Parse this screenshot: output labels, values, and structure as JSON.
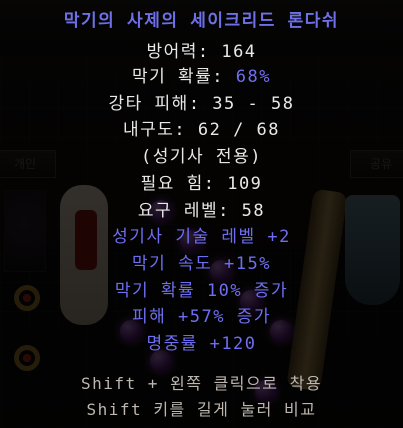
{
  "item": {
    "name": "막기의 사제의 세이크리드 론다쉬",
    "defense_label": "방어력: ",
    "defense_value": "164",
    "block_label": "막기 확률: ",
    "block_value": "68%",
    "smite_label": "강타 피해: ",
    "smite_value": "35 - 58",
    "durability_label": "내구도: ",
    "durability_value": "62 / 68",
    "class_only": "(성기사 전용)",
    "req_str_label": "필요 힘: ",
    "req_str_value": "109",
    "req_level_label": "요구 레벨: ",
    "req_level_value": "58",
    "magic_props": [
      "성기사 기술 레벨 +2",
      "막기 속도 +15%",
      "막기 확률 10% 증가",
      "피해 +57% 증가",
      "명중률 +120"
    ],
    "hints": [
      "Shift + 왼쪽 클릭으로 착용",
      "Shift 키를 길게 눌러 비교"
    ]
  },
  "background": {
    "tab_left_label": "개인",
    "tab_right_label": "공유"
  },
  "colors": {
    "title": "#6f6fe8",
    "magic": "#6e6ef0",
    "base": "#e8e8e8",
    "hint": "#bdb7b0"
  }
}
